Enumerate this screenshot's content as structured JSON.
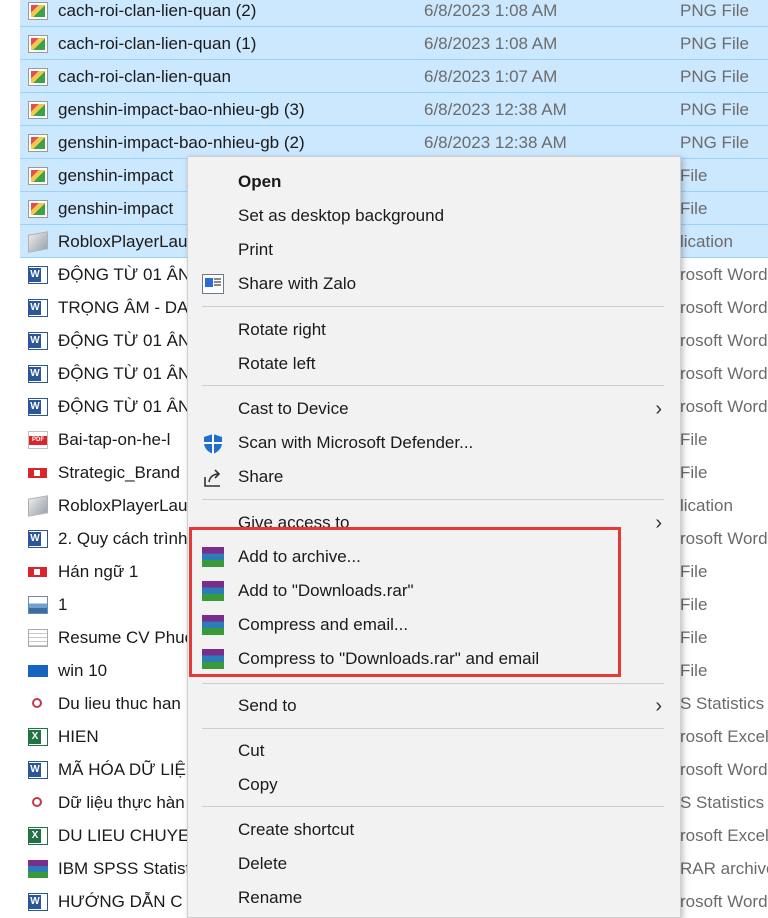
{
  "files": [
    {
      "name": "cach-roi-clan-lien-quan (2)",
      "date": "6/8/2023 1:08 AM",
      "type": "PNG File",
      "icon": "png-file-icon",
      "selected": true
    },
    {
      "name": "cach-roi-clan-lien-quan (1)",
      "date": "6/8/2023 1:08 AM",
      "type": "PNG File",
      "icon": "png-file-icon",
      "selected": true
    },
    {
      "name": "cach-roi-clan-lien-quan",
      "date": "6/8/2023 1:07 AM",
      "type": "PNG File",
      "icon": "png-file-icon",
      "selected": true
    },
    {
      "name": "genshin-impact-bao-nhieu-gb (3)",
      "date": "6/8/2023 12:38 AM",
      "type": "PNG File",
      "icon": "png-file-icon",
      "selected": true
    },
    {
      "name": "genshin-impact-bao-nhieu-gb (2)",
      "date": "6/8/2023 12:38 AM",
      "type": "PNG File",
      "icon": "png-file-icon",
      "selected": true
    },
    {
      "name": "genshin-impact",
      "date": "",
      "type": "File",
      "icon": "png-file-icon",
      "selected": true
    },
    {
      "name": "genshin-impact",
      "date": "",
      "type": "File",
      "icon": "png-file-icon",
      "selected": true
    },
    {
      "name": "RobloxPlayerLau",
      "date": "",
      "type": "lication",
      "icon": "application-icon",
      "selected": true
    },
    {
      "name": "ĐỘNG TỪ 01 ÂN",
      "date": "",
      "type": "rosoft Word",
      "icon": "word-document-icon",
      "selected": false
    },
    {
      "name": "TRỌNG ÂM - DA",
      "date": "",
      "type": "rosoft Word",
      "icon": "word-document-icon",
      "selected": false
    },
    {
      "name": "ĐỘNG TỪ 01 ÂN",
      "date": "",
      "type": "rosoft Word",
      "icon": "word-document-icon",
      "selected": false
    },
    {
      "name": "ĐỘNG TỪ 01 ÂN",
      "date": "",
      "type": "rosoft Word",
      "icon": "word-document-icon",
      "selected": false
    },
    {
      "name": "ĐỘNG TỪ 01 ÂN",
      "date": "",
      "type": "rosoft Word",
      "icon": "word-document-icon",
      "selected": false
    },
    {
      "name": "Bai-tap-on-he-l",
      "date": "",
      "type": "File",
      "icon": "pdf-file-icon",
      "selected": false
    },
    {
      "name": "Strategic_Brand",
      "date": "",
      "type": "File",
      "icon": "powerpoint-file-icon",
      "selected": false
    },
    {
      "name": "RobloxPlayerLau",
      "date": "",
      "type": "lication",
      "icon": "application-icon",
      "selected": false
    },
    {
      "name": "2. Quy cách trình",
      "date": "",
      "type": "rosoft Word",
      "icon": "word-document-icon",
      "selected": false
    },
    {
      "name": "Hán ngữ 1",
      "date": "",
      "type": "File",
      "icon": "powerpoint-file-icon",
      "selected": false
    },
    {
      "name": "1",
      "date": "",
      "type": "File",
      "icon": "image-file-icon",
      "selected": false
    },
    {
      "name": "Resume CV Phuc",
      "date": "",
      "type": "File",
      "icon": "document-image-icon",
      "selected": false
    },
    {
      "name": "win 10",
      "date": "",
      "type": "File",
      "icon": "windows-image-icon",
      "selected": false
    },
    {
      "name": "Du lieu thuc han",
      "date": "",
      "type": "S Statistics I",
      "icon": "spss-data-icon",
      "selected": false
    },
    {
      "name": "HIEN",
      "date": "",
      "type": "rosoft Excel",
      "icon": "excel-file-icon",
      "selected": false
    },
    {
      "name": "MÃ HÓA DỮ LIỆ",
      "date": "",
      "type": "rosoft Word",
      "icon": "word-document-icon",
      "selected": false
    },
    {
      "name": "Dữ liệu thực hàn",
      "date": "",
      "type": "S Statistics I",
      "icon": "spss-data-icon",
      "selected": false
    },
    {
      "name": "DU LIEU CHUYE",
      "date": "",
      "type": "rosoft Excel",
      "icon": "excel-file-icon",
      "selected": false
    },
    {
      "name": "IBM SPSS Statist",
      "date": "",
      "type": "RAR archive",
      "icon": "winrar-archive-icon",
      "selected": false
    },
    {
      "name": "HƯỚNG DẪN C",
      "date": "",
      "type": "rosoft Word",
      "icon": "word-document-icon",
      "selected": false
    }
  ],
  "menu": {
    "open": "Open",
    "set_background": "Set as desktop background",
    "print": "Print",
    "share_zalo": "Share with Zalo",
    "rotate_right": "Rotate right",
    "rotate_left": "Rotate left",
    "cast": "Cast to Device",
    "scan": "Scan with Microsoft Defender...",
    "share": "Share",
    "give_access": "Give access to",
    "add_archive": "Add to archive...",
    "add_rar": "Add to \"Downloads.rar\"",
    "compress_email": "Compress and email...",
    "compress_rar_email": "Compress to \"Downloads.rar\" and email",
    "send_to": "Send to",
    "cut": "Cut",
    "copy": "Copy",
    "create_shortcut": "Create shortcut",
    "delete": "Delete",
    "rename": "Rename"
  },
  "colors": {
    "selection": "#cce8ff",
    "highlight_box": "#e53935",
    "menu_bg": "#f2f2f2"
  }
}
